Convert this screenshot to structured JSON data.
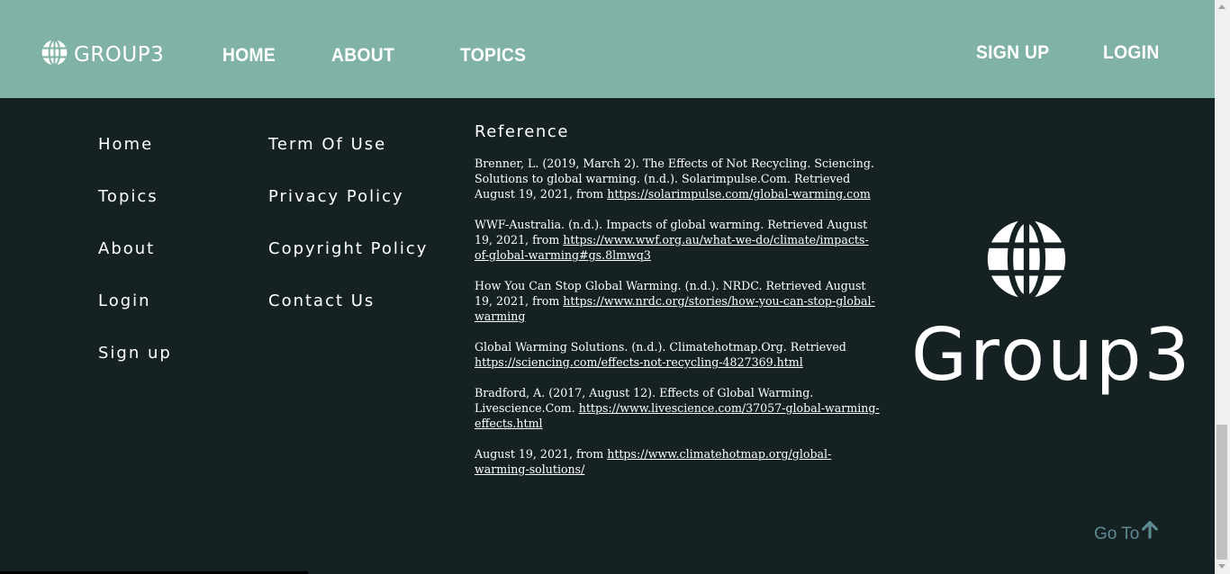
{
  "colors": {
    "header_bg": "#80b2a6",
    "footer_bg": "#162123",
    "text": "#ffffff",
    "go_to": "#5d8a92"
  },
  "header": {
    "brand": "GROUP3",
    "brand_icon": "globe-icon",
    "nav": {
      "home": "HOME",
      "about": "ABOUT",
      "topics": "TOPICS",
      "signup": "SIGN UP",
      "login": "LOGIN"
    }
  },
  "footer": {
    "column1": [
      "Home",
      "Topics",
      "About",
      "Login",
      "Sign up"
    ],
    "column2": [
      "Term Of Use",
      "Privacy Policy",
      "Copyright Policy",
      "Contact Us"
    ],
    "reference_title": "Reference",
    "references": [
      {
        "text": "Brenner, L. (2019, March 2). The Effects of Not Recycling. Sciencing. Solutions to global warming. (n.d.). Solarimpulse.Com. Retrieved August 19, 2021, from ",
        "link": "https://solarimpulse.com/global-warming.com"
      },
      {
        "text": "WWF-Australia. (n.d.). Impacts of global warming. Retrieved August 19, 2021, from ",
        "link": "https://www.wwf.org.au/what-we-do/climate/impacts-of-global-warming#gs.8lmwq3"
      },
      {
        "text": "How You Can Stop Global Warming. (n.d.). NRDC. Retrieved August 19, 2021, from ",
        "link": "https://www.nrdc.org/stories/how-you-can-stop-global-warming"
      },
      {
        "text": "Global Warming Solutions. (n.d.). Climatehotmap.Org. Retrieved ",
        "link": "https://sciencing.com/effects-not-recycling-4827369.html"
      },
      {
        "text": "Bradford, A. (2017, August 12). Effects of Global Warming. Livescience.Com. ",
        "link": "https://www.livescience.com/37057-global-warming-effects.html"
      },
      {
        "text": "August 19, 2021, from ",
        "link": "https://www.climatehotmap.org/global-warming-solutions/"
      }
    ],
    "big_brand": "Group3",
    "big_brand_icon": "globe-icon",
    "go_to": "Go To",
    "go_to_icon": "arrow-up-icon"
  }
}
